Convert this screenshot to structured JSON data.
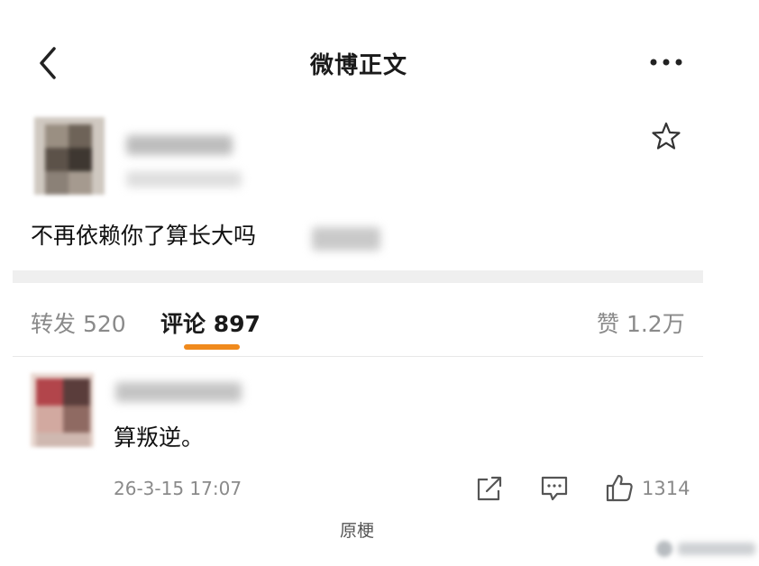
{
  "header": {
    "title": "微博正文",
    "back_icon": "chevron-left-icon",
    "more_icon": "more-horizontal-icon"
  },
  "post": {
    "text": "不再依赖你了算长大吗",
    "favorite_icon": "star-outline-icon"
  },
  "tabs": {
    "repost": "转发 520",
    "comments": "评论 897",
    "likes": "赞 1.2万",
    "active_color": "#f08a1d"
  },
  "comment": {
    "text": "算叛逆。",
    "timestamp": "26-3-15 17:07",
    "share_icon": "share-external-icon",
    "reply_icon": "comment-bubble-icon",
    "like_icon": "thumbs-up-icon",
    "like_count": "1314"
  },
  "caption": "原梗"
}
